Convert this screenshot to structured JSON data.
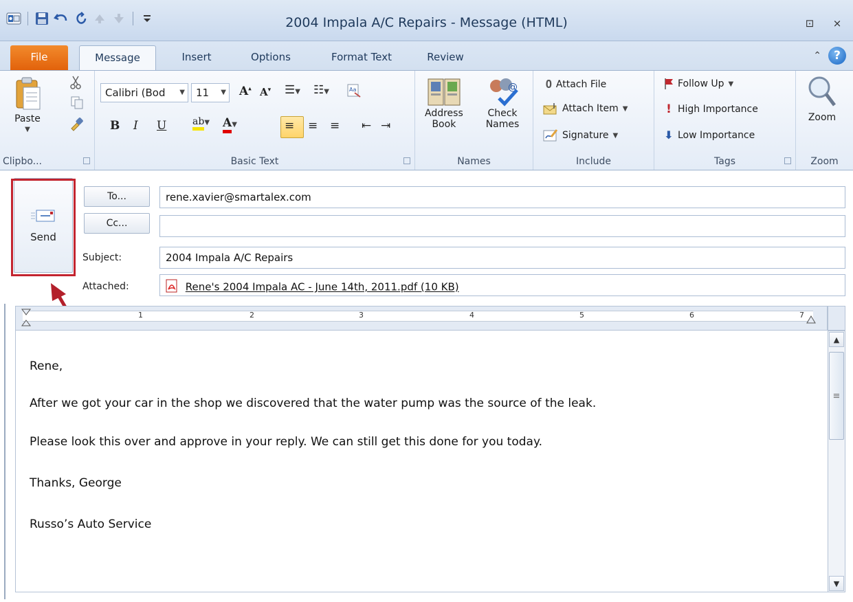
{
  "window": {
    "title": "2004 Impala A/C Repairs - Message (HTML)",
    "restore_glyph": "⊡",
    "close_glyph": "⨯"
  },
  "quick_access": [
    "outlook-icon",
    "save-icon",
    "undo-icon",
    "redo-icon",
    "up-icon",
    "down-icon",
    "customize-icon"
  ],
  "tabs": [
    {
      "label": "File"
    },
    {
      "label": "Message"
    },
    {
      "label": "Insert"
    },
    {
      "label": "Options"
    },
    {
      "label": "Format Text"
    },
    {
      "label": "Review"
    }
  ],
  "ribbon": {
    "clipboard": {
      "paste": "Paste",
      "label": "Clipbo..."
    },
    "basic_text": {
      "font": "Calibri (Body)",
      "font_display": "Calibri (Bod",
      "size": "11",
      "bold": "B",
      "italic": "I",
      "underline": "U",
      "font_color_glyph": "A",
      "highlight_glyph": "ab",
      "label": "Basic Text"
    },
    "names": {
      "address_book_1": "Address",
      "address_book_2": "Book",
      "check_names_1": "Check",
      "check_names_2": "Names",
      "label": "Names"
    },
    "include": {
      "attach_file": "Attach File",
      "attach_item": "Attach Item",
      "signature": "Signature",
      "label": "Include"
    },
    "tags": {
      "follow_up": "Follow Up",
      "high_importance": "High Importance",
      "low_importance": "Low Importance",
      "label": "Tags"
    },
    "zoom": {
      "button": "Zoom",
      "label": "Zoom"
    }
  },
  "form": {
    "send": "Send",
    "to_button": "To...",
    "cc_button": "Cc...",
    "to_value": "rene.xavier@smartalex.com",
    "cc_value": "",
    "subject_label": "Subject:",
    "subject_value": "2004 Impala A/C Repairs",
    "attached_label": "Attached:",
    "attachment": "Rene's 2004 Impala AC - June 14th, 2011.pdf (10 KB)"
  },
  "ruler": {
    "numbers": [
      "1",
      "2",
      "3",
      "4",
      "5",
      "6",
      "7"
    ]
  },
  "message_body": {
    "greeting": "Rene,",
    "paragraph_1": "After we got your car in the shop we discovered that the water pump was the source of the leak.",
    "paragraph_2": "Please look this over and approve in your reply. We can still get this done for you today.",
    "signoff": "Thanks, George",
    "company": "Russo’s Auto Service"
  },
  "colors": {
    "accent_file": "#e2620b",
    "highlight_border": "#c3242f",
    "arrow": "#b3202b"
  }
}
